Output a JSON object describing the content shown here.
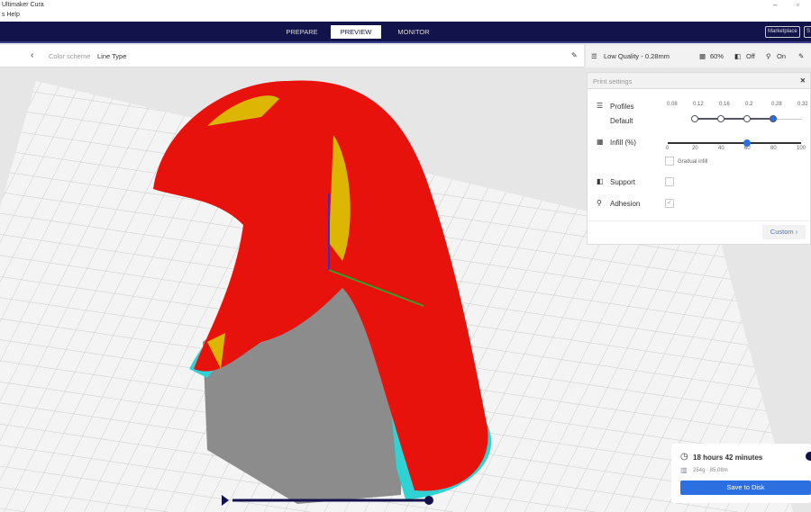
{
  "window": {
    "title": "Ultimaker Cura",
    "minimize": "–",
    "restore": "▫"
  },
  "menu": {
    "items": "s Help"
  },
  "nav": {
    "tabs": [
      {
        "label": "PREPARE"
      },
      {
        "label": "PREVIEW",
        "active": true
      },
      {
        "label": "MONITOR"
      }
    ],
    "marketplace": "Marketplace",
    "signin": "S"
  },
  "colorbar": {
    "back": "‹",
    "label": "Color scheme",
    "value": "Line Type",
    "edit": "✎"
  },
  "settings_bar": {
    "profile": "Low Quality - 0.28mm",
    "infill": "60%",
    "support": "Off",
    "adhesion": "On",
    "edit": "✎"
  },
  "print_settings": {
    "title": "Print settings",
    "close": "✕",
    "profiles_label": "Profiles",
    "profile_name": "Default",
    "layer_heights": [
      "0.08",
      "0.12",
      "0.16",
      "0.2",
      "0.28",
      "0.32"
    ],
    "selected_layer_height": "0.28",
    "infill_label": "Infill (%)",
    "infill_ticks": [
      "0",
      "20",
      "40",
      "60",
      "80",
      "100"
    ],
    "infill_value": 60,
    "gradual_label": "Gradual infill",
    "gradual": false,
    "support_label": "Support",
    "support": false,
    "adhesion_label": "Adhesion",
    "adhesion": true,
    "custom_label": "Custom"
  },
  "summary": {
    "time": "18 hours 42 minutes",
    "material": "254g · 85.08m",
    "save": "Save to Disk"
  },
  "colors": {
    "nav": "#12134a",
    "accent": "#2c6fe0",
    "model": "#e8120c",
    "skirt": "#2fd3d3",
    "infill": "#d8e000"
  }
}
